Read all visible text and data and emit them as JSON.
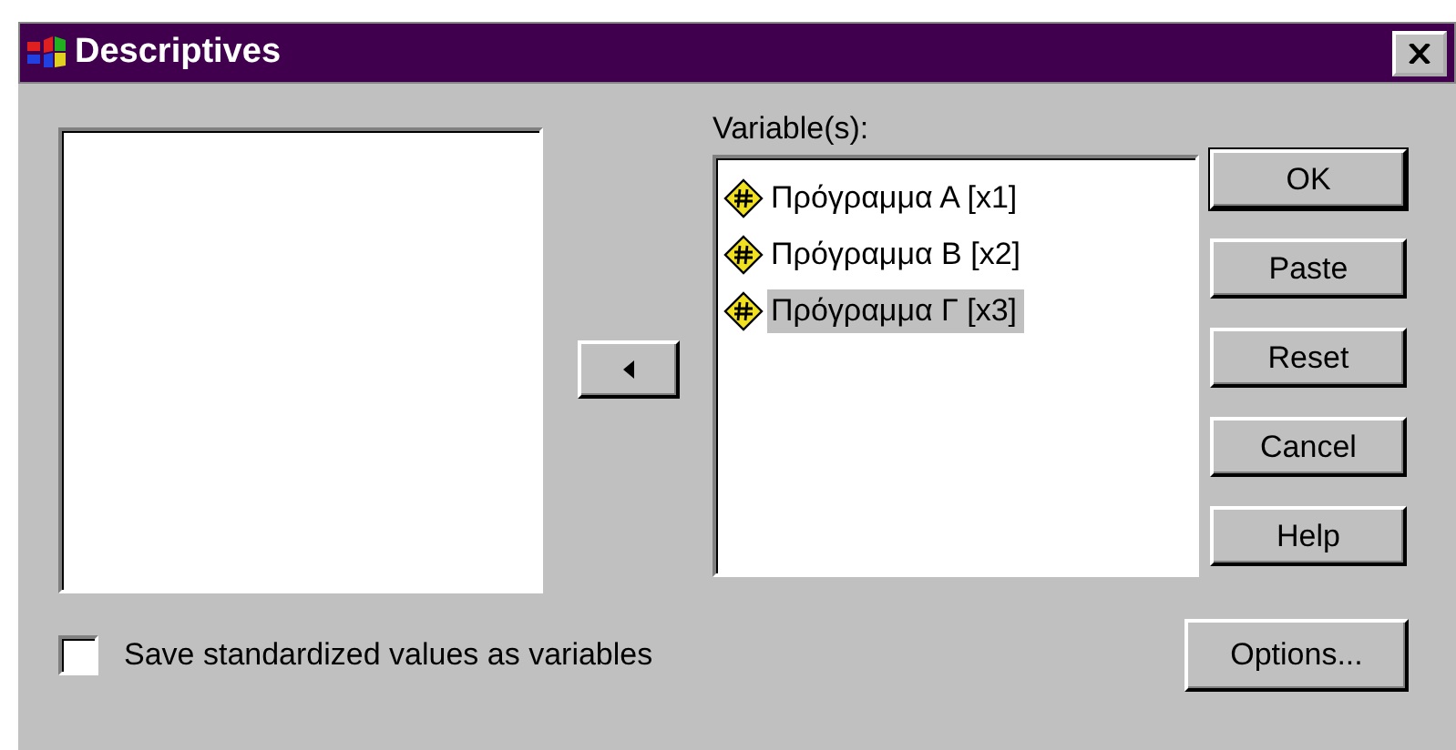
{
  "window": {
    "title": "Descriptives"
  },
  "target_list": {
    "label": "Variable(s):",
    "items": [
      {
        "label": "Πρόγραμμα Α [x1]",
        "selected": false
      },
      {
        "label": "Πρόγραμμα Β [x2]",
        "selected": false
      },
      {
        "label": "Πρόγραμμα Γ [x3]",
        "selected": true
      }
    ]
  },
  "buttons": [
    {
      "label": "OK",
      "default": true
    },
    {
      "label": "Paste",
      "default": false
    },
    {
      "label": "Reset",
      "default": false
    },
    {
      "label": "Cancel",
      "default": false
    },
    {
      "label": "Help",
      "default": false
    }
  ],
  "save_option": {
    "label": "Save standardized values as variables",
    "checked": false
  },
  "options_button": {
    "label": "Options..."
  }
}
